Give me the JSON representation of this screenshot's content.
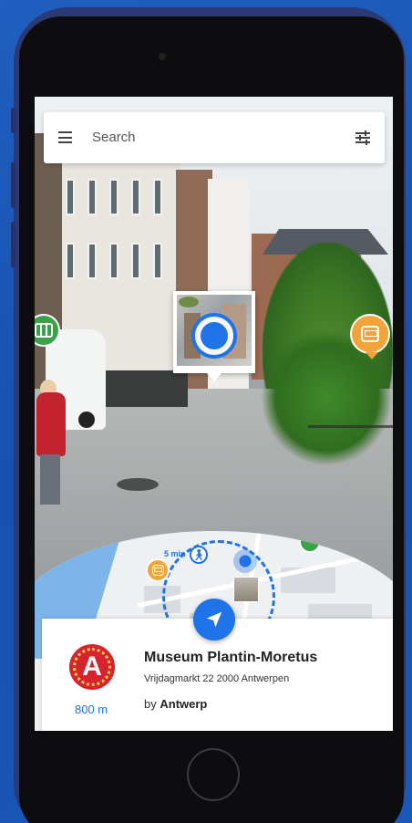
{
  "search": {
    "placeholder": "Search"
  },
  "minimap": {
    "walk_time": "5 min"
  },
  "poi": {
    "title": "Museum Plantin-Moretus",
    "address": "Vrijdagmarkt 22 2000 Antwerpen",
    "by_prefix": "by",
    "by_name": "Antwerp",
    "distance": "800 m",
    "logo_letter": "A"
  },
  "colors": {
    "accent": "#1f73e8",
    "logo_red": "#d8232f",
    "bus_orange": "#f2a33b",
    "tram_green": "#3aa34a",
    "background": "#1a58b8",
    "phone_frame": "#2b3a74"
  },
  "icons": {
    "menu": "hamburger-menu-icon",
    "filter": "sliders-icon",
    "bus": "bus-icon",
    "tram": "tram-icon",
    "walk": "pedestrian-icon",
    "navigate": "navigation-arrow-icon"
  }
}
